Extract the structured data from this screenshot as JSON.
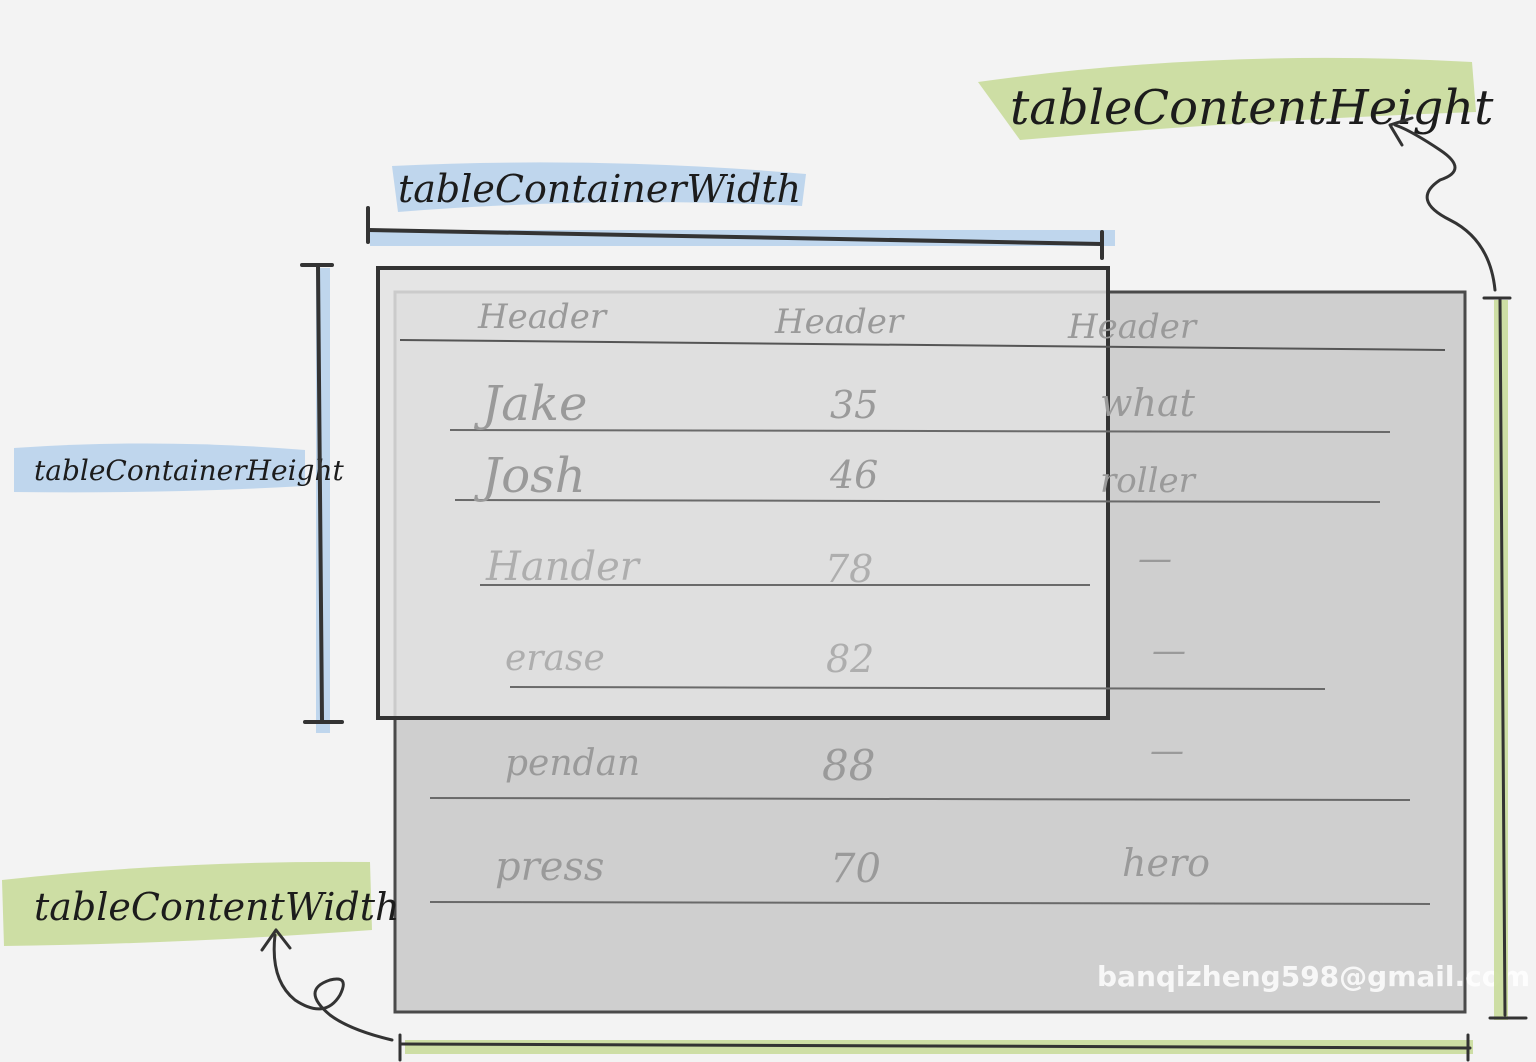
{
  "labels": {
    "container_width": "tableContainerWidth",
    "container_height": "tableContainerHeight",
    "content_width": "tableContentWidth",
    "content_height": "tableContentHeight"
  },
  "table": {
    "headers": [
      "Header",
      "Header",
      "Header"
    ],
    "rows": [
      [
        "Jake",
        "35",
        "what"
      ],
      [
        "Josh",
        "46",
        "roller"
      ],
      [
        "Hander",
        "78",
        "—"
      ],
      [
        "erase",
        "82",
        "—"
      ],
      [
        "pendan",
        "88",
        "—"
      ],
      [
        "press",
        "70",
        "hero"
      ]
    ]
  },
  "watermark": "banqizheng598@gmail.com",
  "colors": {
    "background": "#f3f3f3",
    "content_fill": "#cfcfcf",
    "container_fill": "#e0e0e0",
    "blue_highlight": "#b9d3ec",
    "green_highlight": "#c9dc9b",
    "ink": "#2e2e2e"
  }
}
